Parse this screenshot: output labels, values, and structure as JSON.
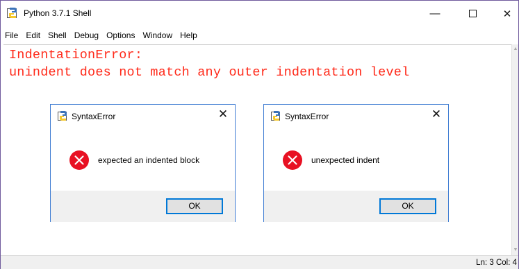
{
  "window": {
    "title": "Python 3.7.1 Shell",
    "controls": {
      "minimize": "—",
      "close": "✕"
    }
  },
  "menu": [
    "File",
    "Edit",
    "Shell",
    "Debug",
    "Options",
    "Window",
    "Help"
  ],
  "editor": {
    "lines": [
      "IndentationError:",
      "unindent does not match any outer indentation level"
    ],
    "text_color": "#ff2a1a"
  },
  "statusbar": {
    "text": "Ln: 3   Col: 4"
  },
  "dialogs": [
    {
      "title": "SyntaxError",
      "icon": "error-icon",
      "message": "expected an indented block",
      "ok_label": "OK",
      "close": "✕"
    },
    {
      "title": "SyntaxError",
      "icon": "error-icon",
      "message": "unexpected indent",
      "ok_label": "OK",
      "close": "✕"
    }
  ],
  "colors": {
    "dialog_border": "#3d7bd2",
    "ok_border": "#0078d7",
    "error_icon": "#e81123"
  }
}
